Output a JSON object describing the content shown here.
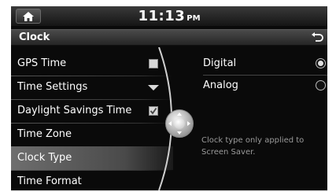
{
  "status_bar": {
    "time": "11:13",
    "ampm": "PM"
  },
  "header": {
    "title": "Clock"
  },
  "menu": {
    "items": [
      {
        "label": "GPS Time",
        "control": "checkbox",
        "checked": false
      },
      {
        "label": "Time Settings",
        "control": "dropdown"
      },
      {
        "label": "Daylight Savings Time",
        "control": "checkbox",
        "checked": true
      },
      {
        "label": "Time Zone"
      },
      {
        "label": "Clock Type",
        "selected": true
      },
      {
        "label": "Time Format"
      }
    ]
  },
  "clock_type": {
    "options": [
      {
        "label": "Digital",
        "selected": true
      },
      {
        "label": "Analog",
        "selected": false
      }
    ],
    "note": "Clock type only applied to Screen Saver."
  },
  "colors": {
    "background": "#0a0a0a",
    "text": "#ffffff",
    "note_text": "#9a9a9a",
    "selected_row": "#6e6e6e"
  }
}
